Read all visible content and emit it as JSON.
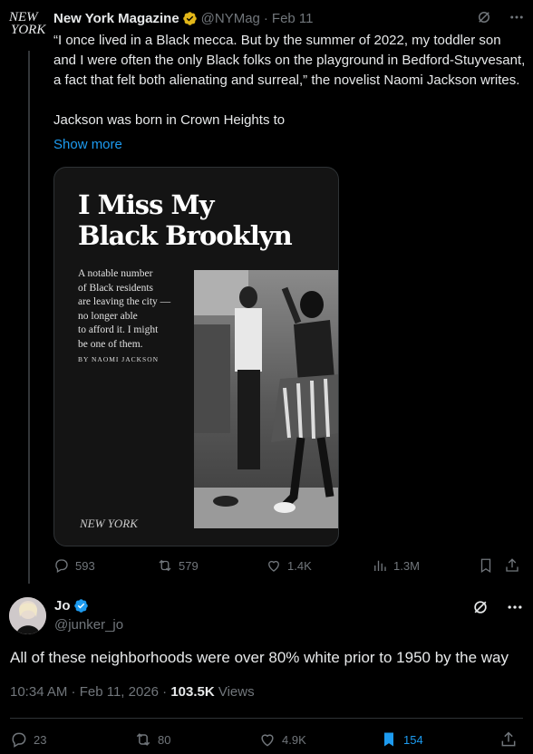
{
  "parent_tweet": {
    "author_name": "New York Magazine",
    "handle": "@NYMag",
    "date": "Feb 11",
    "avatar_text_1": "NEW",
    "avatar_text_2": "YORK",
    "text": "“I once lived in a Black mecca. But by the summer of 2022, my toddler son and I were often the only Black folks on the playground in Bedford-Stuyvesant, a fact that felt both alienating and surreal,” the novelist Naomi Jackson writes.\n\nJackson was born in Crown Heights to",
    "show_more": "Show more",
    "media": {
      "title_line1": "I Miss My",
      "title_line2": "Black Brooklyn",
      "subtitle": "A notable number\nof Black residents\nare leaving the city —\nno longer able\nto afford it. I might\nbe one of them.",
      "byline": "BY NAOMI JACKSON",
      "logo": "NEW YORK"
    },
    "actions": {
      "replies": "593",
      "reposts": "579",
      "likes": "1.4K",
      "views": "1.3M"
    },
    "badge_color": "#e2b719"
  },
  "main_tweet": {
    "author_name": "Jo",
    "handle": "@junker_jo",
    "text": "All of these neighborhoods were over 80% white prior to 1950 by the way",
    "time": "10:34 AM · Feb 11, 2026 · ",
    "views_count": "103.5K",
    "views_label": " Views",
    "actions": {
      "replies": "23",
      "reposts": "80",
      "likes": "4.9K",
      "bookmarks": "154"
    },
    "badge_color": "#1d9bf0",
    "bookmark_active_color": "#1d9bf0"
  }
}
